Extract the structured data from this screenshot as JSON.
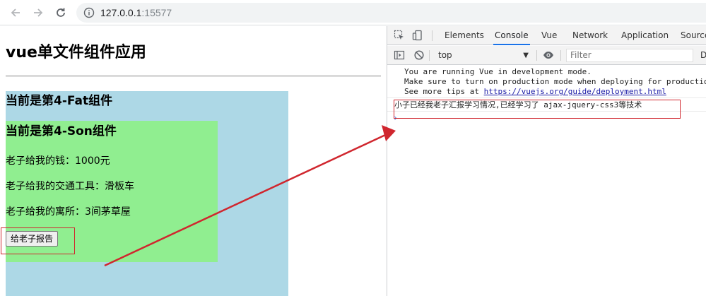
{
  "browser": {
    "url_host": "127.0.0.1",
    "url_port": ":15577"
  },
  "page": {
    "title": "vue单文件组件应用",
    "fat": {
      "title": "当前是第4-Fat组件",
      "son": {
        "title": "当前是第4-Son组件",
        "lines": [
          "老子给我的钱：1000元",
          "老子给我的交通工具：滑板车",
          "老子给我的寓所：3间茅草屋"
        ],
        "button_label": "给老子报告"
      }
    }
  },
  "devtools": {
    "tabs": [
      "Elements",
      "Console",
      "Vue",
      "Network",
      "Application",
      "Source"
    ],
    "active_tab": "Console",
    "context": "top",
    "filter_placeholder": "Filter",
    "levels_label": "D",
    "console": {
      "vue_notice": [
        "You are running Vue in development mode.",
        "Make sure to turn on production mode when deploying for productio",
        "See more tips at "
      ],
      "vue_notice_link": "https://vuejs.org/guide/deployment.html",
      "log_message": "小子已经我老子汇报学习情况,已经学习了 ajax-jquery-css3等技术",
      "prompt": "›"
    }
  },
  "colors": {
    "fat_bg": "#add8e6",
    "son_bg": "#90ee90",
    "annotation_red": "#d0262e",
    "devtools_accent": "#1a73e8"
  }
}
